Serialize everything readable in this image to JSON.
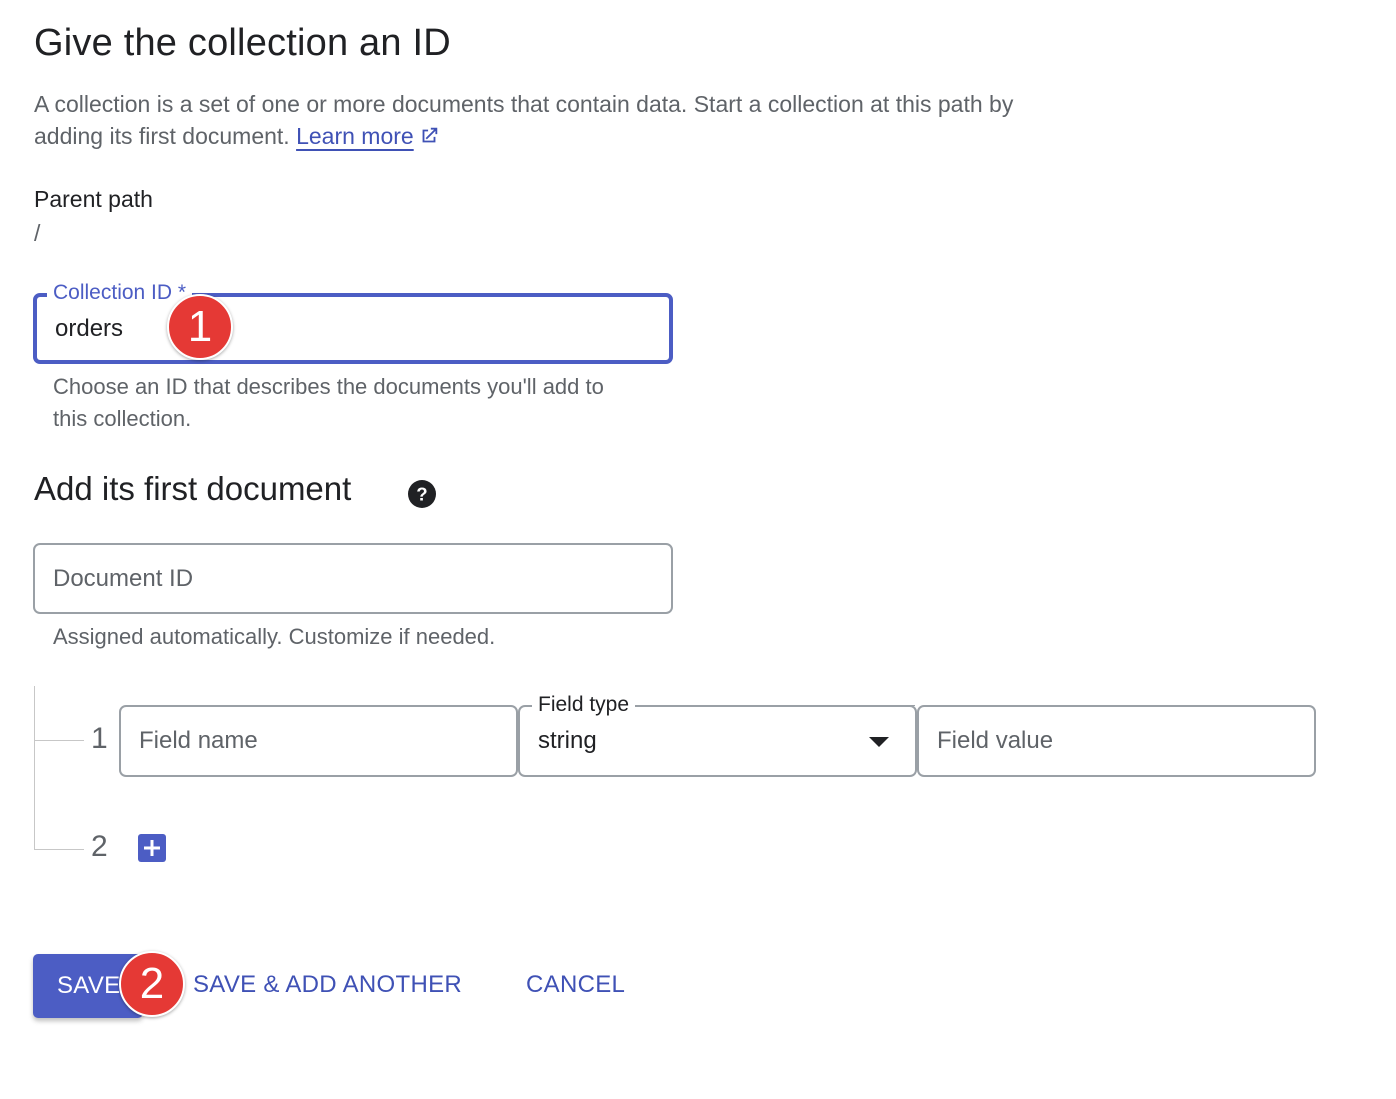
{
  "section1": {
    "title": "Give the collection an ID",
    "description": "A collection is a set of one or more documents that contain data. Start a collection at this path by adding its first document.",
    "learn_more": "Learn more",
    "parent_path_label": "Parent path",
    "parent_path_value": "/"
  },
  "collection_id": {
    "label": "Collection ID *",
    "value": "orders",
    "hint": "Choose an ID that describes the documents you'll add to this collection."
  },
  "section2": {
    "title": "Add its first document",
    "help_icon": "help-circle-icon"
  },
  "document_id": {
    "placeholder": "Document ID",
    "hint": "Assigned automatically. Customize if needed."
  },
  "fields": {
    "rows": [
      {
        "index": "1",
        "field_name_placeholder": "Field name",
        "field_type_label": "Field type",
        "field_type_value": "string",
        "field_value_placeholder": "Field value"
      }
    ],
    "next_index": "2",
    "add_icon": "plus-icon"
  },
  "actions": {
    "save": "SAVE",
    "save_add_another": "SAVE & ADD ANOTHER",
    "cancel": "CANCEL"
  },
  "annotations": {
    "badge1": "1",
    "badge2": "2"
  },
  "colors": {
    "accent": "#4c5dc4",
    "link": "#3f51b5",
    "badge": "#e53935"
  }
}
